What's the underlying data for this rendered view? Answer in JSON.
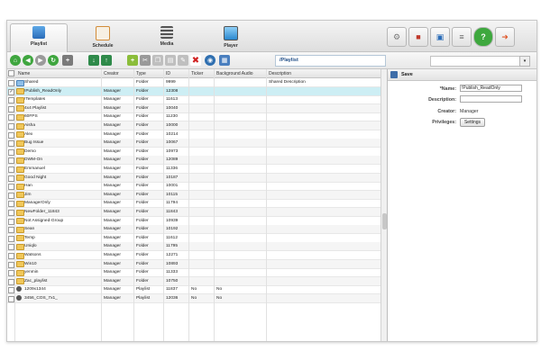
{
  "nav_tabs": [
    {
      "label": "Playlist",
      "active": true
    },
    {
      "label": "Schedule",
      "active": false
    },
    {
      "label": "Media",
      "active": false
    },
    {
      "label": "Player",
      "active": false
    }
  ],
  "top_right_icons": [
    "settings-icon",
    "users-icon",
    "monitor-search-icon",
    "database-icon",
    "help-icon",
    "logout-icon"
  ],
  "path": "/Playlist",
  "search_placeholder": "",
  "columns": [
    "Name",
    "Creator",
    "Type",
    "ID",
    "Ticker",
    "Background Audio",
    "Description"
  ],
  "rows": [
    {
      "name": "Shared",
      "creator": "",
      "type": "Folder",
      "id": "9999",
      "ticker": "",
      "bg_audio": "",
      "description": "Shared Description",
      "icon": "shared"
    },
    {
      "name": "!Publish_ReadOnly",
      "creator": "Manager",
      "type": "Folder",
      "id": "12308",
      "ticker": "",
      "bg_audio": "",
      "description": "",
      "icon": "folder",
      "selected": true
    },
    {
      "name": "!Templates",
      "creator": "Manager",
      "type": "Folder",
      "id": "11613",
      "ticker": "",
      "bg_audio": "",
      "description": "",
      "icon": "folder"
    },
    {
      "name": "4x4 Playlist",
      "creator": "Manager",
      "type": "Folder",
      "id": "10040",
      "ticker": "",
      "bg_audio": "",
      "description": "",
      "icon": "folder"
    },
    {
      "name": "60FPS",
      "creator": "Manager",
      "type": "Folder",
      "id": "11230",
      "ticker": "",
      "bg_audio": "",
      "description": "",
      "icon": "folder"
    },
    {
      "name": "Aisha",
      "creator": "Manager",
      "type": "Folder",
      "id": "10000",
      "ticker": "",
      "bg_audio": "",
      "description": "",
      "icon": "folder"
    },
    {
      "name": "Alex",
      "creator": "Manager",
      "type": "Folder",
      "id": "10214",
      "ticker": "",
      "bg_audio": "",
      "description": "",
      "icon": "folder"
    },
    {
      "name": "Bug Issue",
      "creator": "Manager",
      "type": "Folder",
      "id": "10067",
      "ticker": "",
      "bg_audio": "",
      "description": "",
      "icon": "folder"
    },
    {
      "name": "Demo",
      "creator": "Manager",
      "type": "Folder",
      "id": "10973",
      "ticker": "",
      "bg_audio": "",
      "description": "",
      "icon": "folder"
    },
    {
      "name": "DWM-On",
      "creator": "Manager",
      "type": "Folder",
      "id": "12089",
      "ticker": "",
      "bg_audio": "",
      "description": "",
      "icon": "folder"
    },
    {
      "name": "Emmanuel",
      "creator": "Manager",
      "type": "Folder",
      "id": "11336",
      "ticker": "",
      "bg_audio": "",
      "description": "",
      "icon": "folder"
    },
    {
      "name": "Good Night",
      "creator": "Manager",
      "type": "Folder",
      "id": "10187",
      "ticker": "",
      "bg_audio": "",
      "description": "",
      "icon": "folder"
    },
    {
      "name": "Han",
      "creator": "Manager",
      "type": "Folder",
      "id": "10001",
      "ticker": "",
      "bg_audio": "",
      "description": "",
      "icon": "folder"
    },
    {
      "name": "Jim",
      "creator": "Manager",
      "type": "Folder",
      "id": "10115",
      "ticker": "",
      "bg_audio": "",
      "description": "",
      "icon": "folder"
    },
    {
      "name": "ManagerOnly",
      "creator": "Manager",
      "type": "Folder",
      "id": "11794",
      "ticker": "",
      "bg_audio": "",
      "description": "",
      "icon": "folder"
    },
    {
      "name": "NewFolder_11843",
      "creator": "Manager",
      "type": "Folder",
      "id": "11843",
      "ticker": "",
      "bg_audio": "",
      "description": "",
      "icon": "folder"
    },
    {
      "name": "Not Assigned-Group",
      "creator": "Manager",
      "type": "Folder",
      "id": "10939",
      "ticker": "",
      "bg_audio": "",
      "description": "",
      "icon": "folder"
    },
    {
      "name": "Sean",
      "creator": "Manager",
      "type": "Folder",
      "id": "10192",
      "ticker": "",
      "bg_audio": "",
      "description": "",
      "icon": "folder"
    },
    {
      "name": "Temp",
      "creator": "Manager",
      "type": "Folder",
      "id": "11612",
      "ticker": "",
      "bg_audio": "",
      "description": "",
      "icon": "folder"
    },
    {
      "name": "Uniqlo",
      "creator": "Manager",
      "type": "Folder",
      "id": "11795",
      "ticker": "",
      "bg_audio": "",
      "description": "",
      "icon": "folder"
    },
    {
      "name": "Watsons",
      "creator": "Manager",
      "type": "Folder",
      "id": "12271",
      "ticker": "",
      "bg_audio": "",
      "description": "",
      "icon": "folder"
    },
    {
      "name": "Win10",
      "creator": "Manager",
      "type": "Folder",
      "id": "10893",
      "ticker": "",
      "bg_audio": "",
      "description": "",
      "icon": "folder"
    },
    {
      "name": "yenmin",
      "creator": "Manager",
      "type": "Folder",
      "id": "11333",
      "ticker": "",
      "bg_audio": "",
      "description": "",
      "icon": "folder"
    },
    {
      "name": "Zac_playlist",
      "creator": "Manager",
      "type": "Folder",
      "id": "10750",
      "ticker": "",
      "bg_audio": "",
      "description": "",
      "icon": "folder"
    },
    {
      "name": "1209x1344",
      "creator": "Manager",
      "type": "Playlist",
      "id": "11837",
      "ticker": "No",
      "bg_audio": "No",
      "description": "",
      "icon": "playlist"
    },
    {
      "name": "3456_COS_7x1_",
      "creator": "Manager",
      "type": "Playlist",
      "id": "12036",
      "ticker": "No",
      "bg_audio": "No",
      "description": "",
      "icon": "playlist"
    }
  ],
  "detail": {
    "save_label": "Save",
    "name_label": "*Name:",
    "name_value": "!Publish_ReadOnly",
    "description_label": "Description:",
    "description_value": "",
    "creator_label": "Creator:",
    "creator_value": "Manager",
    "privileges_label": "Privileges:",
    "settings_button": "Settings"
  }
}
